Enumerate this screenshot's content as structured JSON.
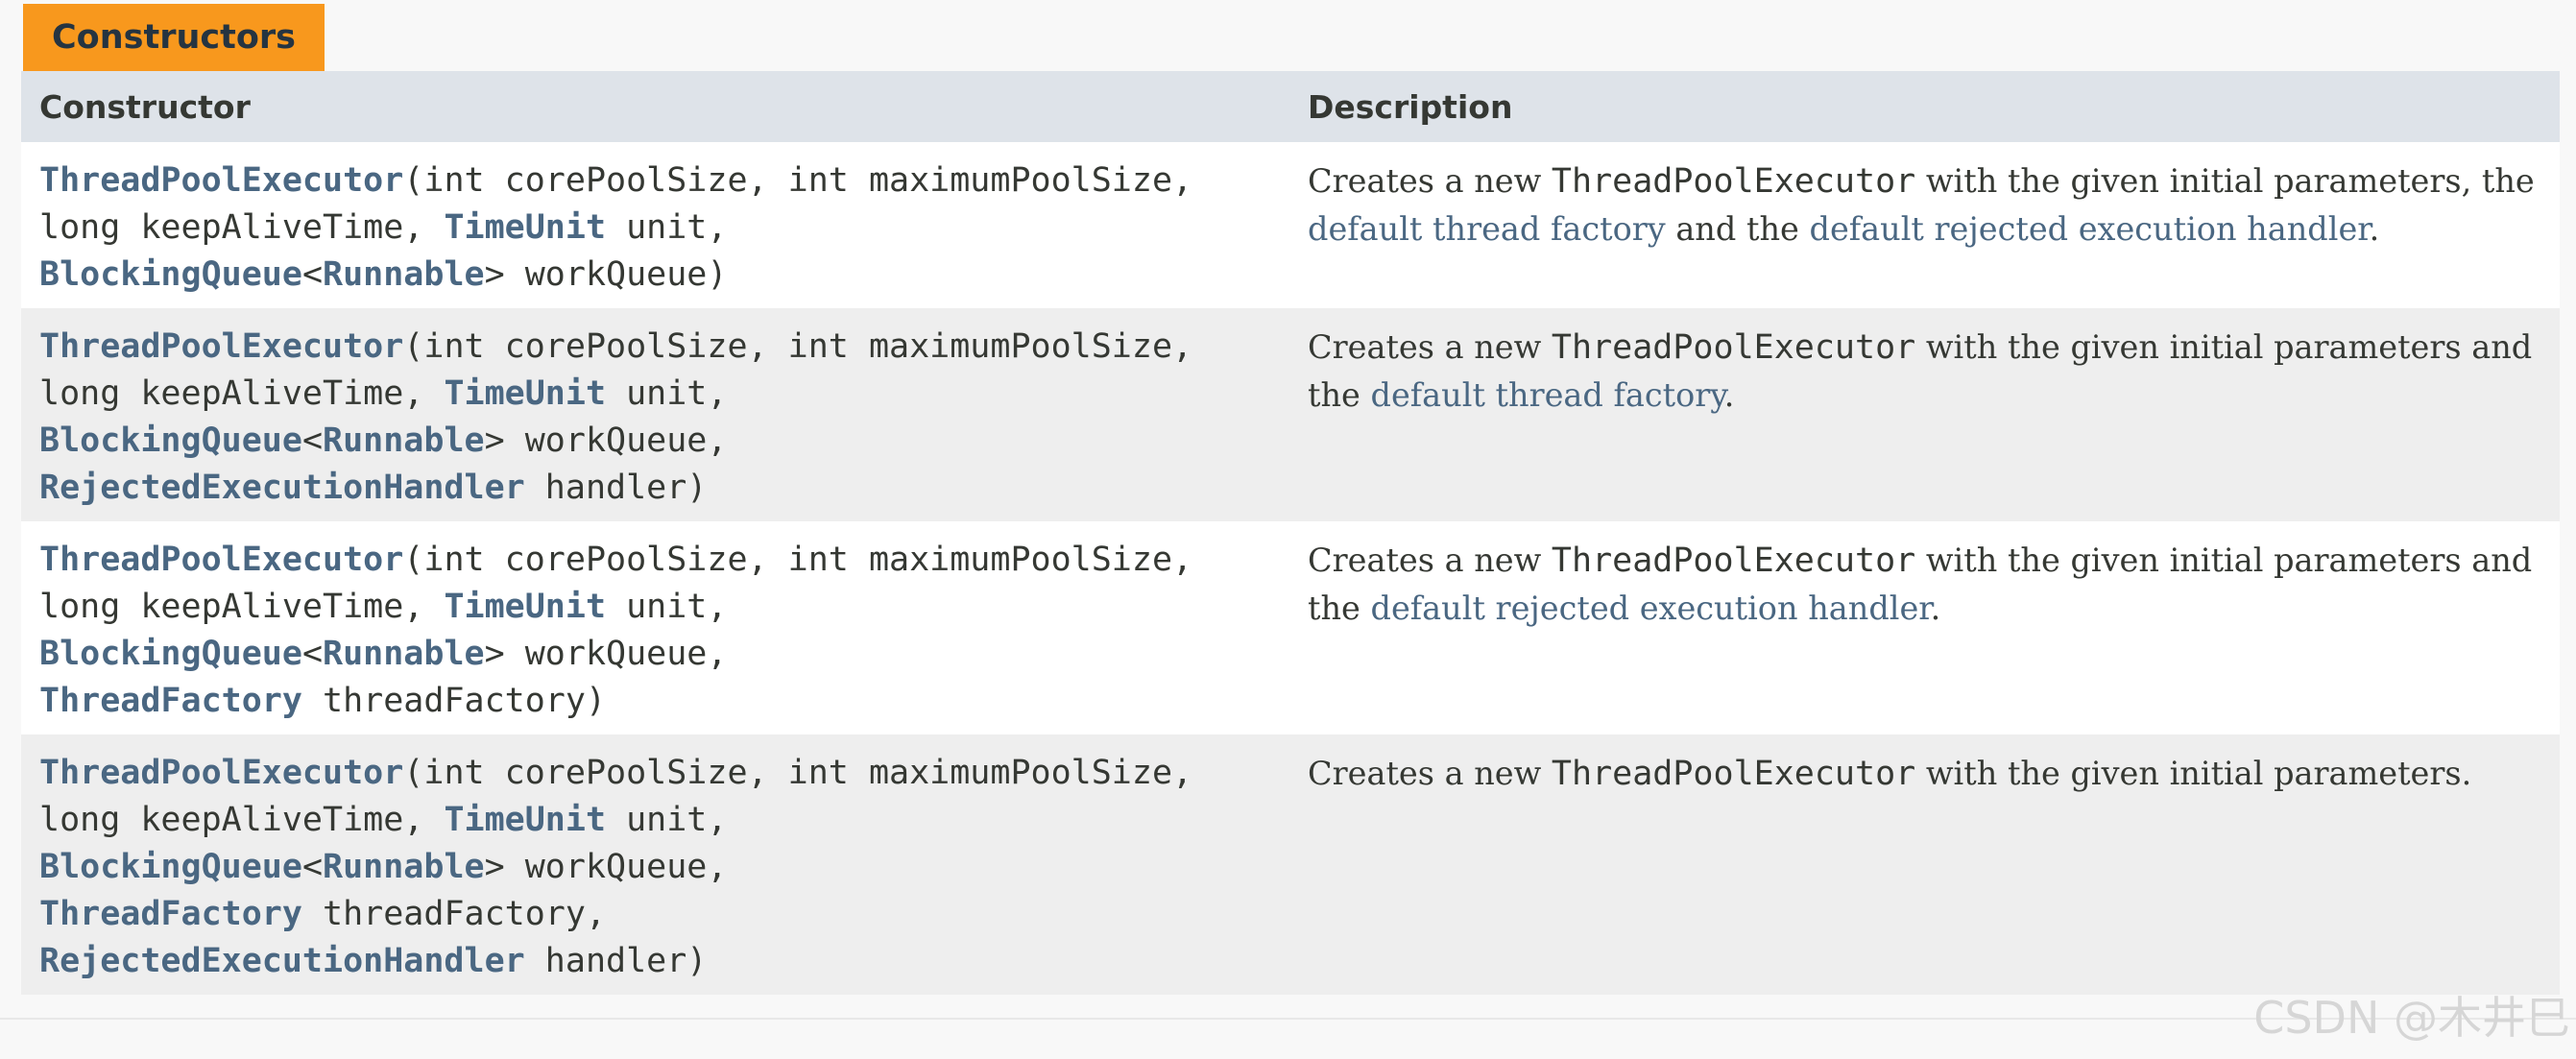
{
  "caption": "Constructors",
  "headers": {
    "constructor": "Constructor",
    "description": "Description"
  },
  "rows": [
    {
      "sig": [
        [
          {
            "t": "ThreadPoolExecutor",
            "l": true
          },
          {
            "t": "(int corePoolSize, int maximumPoolSize,"
          }
        ],
        [
          {
            "t": "long keepAliveTime, "
          },
          {
            "t": "TimeUnit",
            "l": true
          },
          {
            "t": " unit,"
          }
        ],
        [
          {
            "t": "BlockingQueue",
            "l": true
          },
          {
            "t": "<"
          },
          {
            "t": "Runnable",
            "l": true
          },
          {
            "t": "> workQueue)"
          }
        ]
      ],
      "desc": [
        {
          "t": "Creates a new "
        },
        {
          "t": "ThreadPoolExecutor",
          "c": true
        },
        {
          "t": " with the given initial parameters, the "
        },
        {
          "t": "default thread factory",
          "l": true
        },
        {
          "t": " and the "
        },
        {
          "t": "default rejected execution handler",
          "l": true
        },
        {
          "t": "."
        }
      ]
    },
    {
      "sig": [
        [
          {
            "t": "ThreadPoolExecutor",
            "l": true
          },
          {
            "t": "(int corePoolSize, int maximumPoolSize,"
          }
        ],
        [
          {
            "t": "long keepAliveTime, "
          },
          {
            "t": "TimeUnit",
            "l": true
          },
          {
            "t": " unit,"
          }
        ],
        [
          {
            "t": "BlockingQueue",
            "l": true
          },
          {
            "t": "<"
          },
          {
            "t": "Runnable",
            "l": true
          },
          {
            "t": "> workQueue,"
          }
        ],
        [
          {
            "t": "RejectedExecutionHandler",
            "l": true
          },
          {
            "t": " handler)"
          }
        ]
      ],
      "desc": [
        {
          "t": "Creates a new "
        },
        {
          "t": "ThreadPoolExecutor",
          "c": true
        },
        {
          "t": " with the given initial parameters and the "
        },
        {
          "t": "default thread factory",
          "l": true
        },
        {
          "t": "."
        }
      ]
    },
    {
      "sig": [
        [
          {
            "t": "ThreadPoolExecutor",
            "l": true
          },
          {
            "t": "(int corePoolSize, int maximumPoolSize,"
          }
        ],
        [
          {
            "t": "long keepAliveTime, "
          },
          {
            "t": "TimeUnit",
            "l": true
          },
          {
            "t": " unit,"
          }
        ],
        [
          {
            "t": "BlockingQueue",
            "l": true
          },
          {
            "t": "<"
          },
          {
            "t": "Runnable",
            "l": true
          },
          {
            "t": "> workQueue,"
          }
        ],
        [
          {
            "t": "ThreadFactory",
            "l": true
          },
          {
            "t": " threadFactory)"
          }
        ]
      ],
      "desc": [
        {
          "t": "Creates a new "
        },
        {
          "t": "ThreadPoolExecutor",
          "c": true
        },
        {
          "t": " with the given initial parameters and the "
        },
        {
          "t": "default rejected execution handler",
          "l": true
        },
        {
          "t": "."
        }
      ]
    },
    {
      "sig": [
        [
          {
            "t": "ThreadPoolExecutor",
            "l": true
          },
          {
            "t": "(int corePoolSize, int maximumPoolSize,"
          }
        ],
        [
          {
            "t": "long keepAliveTime, "
          },
          {
            "t": "TimeUnit",
            "l": true
          },
          {
            "t": " unit,"
          }
        ],
        [
          {
            "t": "BlockingQueue",
            "l": true
          },
          {
            "t": "<"
          },
          {
            "t": "Runnable",
            "l": true
          },
          {
            "t": "> workQueue,"
          }
        ],
        [
          {
            "t": "ThreadFactory",
            "l": true
          },
          {
            "t": " threadFactory,"
          }
        ],
        [
          {
            "t": "RejectedExecutionHandler",
            "l": true
          },
          {
            "t": " handler)"
          }
        ]
      ],
      "desc": [
        {
          "t": "Creates a new "
        },
        {
          "t": "ThreadPoolExecutor",
          "c": true
        },
        {
          "t": " with the given initial parameters."
        }
      ]
    }
  ],
  "watermark": "CSDN @木井巳",
  "colors": {
    "caption_bg": "#f8981d",
    "header_bg": "#dee3e9",
    "link": "#4a6782",
    "row_alt": "#eeeeee"
  }
}
